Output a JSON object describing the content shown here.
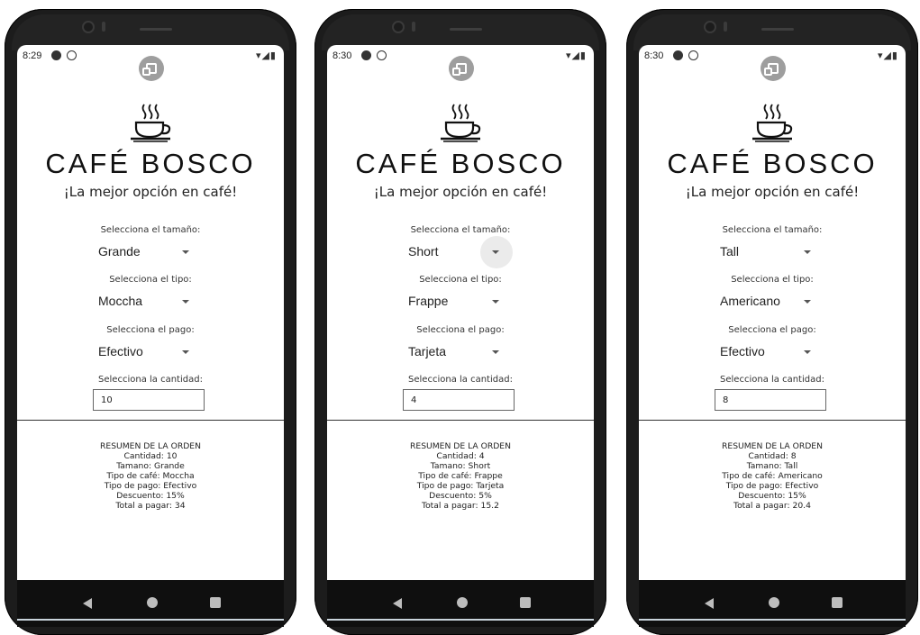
{
  "phones": [
    {
      "time": "8:29",
      "brand": "CAFÉ BOSCO",
      "tagline": "¡La mejor opción en café!",
      "size_label": "Selecciona el tamaño:",
      "size_value": "Grande",
      "type_label": "Selecciona el tipo:",
      "type_value": "Moccha",
      "payment_label": "Selecciona el pago:",
      "payment_value": "Efectivo",
      "quantity_label": "Selecciona la cantidad:",
      "quantity_value": "10",
      "summary": {
        "title": "RESUMEN DE LA ORDEN",
        "quantity": "Cantidad:   10",
        "size": "Tamano:   Grande",
        "coffee_type": "Tipo de café:    Moccha",
        "payment_type": "Tipo de pago:   Efectivo",
        "discount": "Descuento:   15%",
        "total": "Total a pagar:   34"
      }
    },
    {
      "time": "8:30",
      "brand": "CAFÉ BOSCO",
      "tagline": "¡La mejor opción en café!",
      "size_label": "Selecciona el tamaño:",
      "size_value": "Short",
      "type_label": "Selecciona el tipo:",
      "type_value": "Frappe",
      "payment_label": "Selecciona el pago:",
      "payment_value": "Tarjeta",
      "quantity_label": "Selecciona la cantidad:",
      "quantity_value": "4",
      "summary": {
        "title": "RESUMEN DE LA ORDEN",
        "quantity": "Cantidad:   4",
        "size": "Tamano:   Short",
        "coffee_type": "Tipo de café:    Frappe",
        "payment_type": "Tipo de pago:   Tarjeta",
        "discount": "Descuento:   5%",
        "total": "Total a pagar:   15.2"
      }
    },
    {
      "time": "8:30",
      "brand": "CAFÉ BOSCO",
      "tagline": "¡La mejor opción en café!",
      "size_label": "Selecciona el tamaño:",
      "size_value": "Tall",
      "type_label": "Selecciona el tipo:",
      "type_value": "Americano",
      "payment_label": "Selecciona el pago:",
      "payment_value": "Efectivo",
      "quantity_label": "Selecciona la cantidad:",
      "quantity_value": "8",
      "summary": {
        "title": "RESUMEN DE LA ORDEN",
        "quantity": "Cantidad:   8",
        "size": "Tamano:   Tall",
        "coffee_type": "Tipo de café:   Americano",
        "payment_type": "Tipo de pago:   Efectivo",
        "discount": "Descuento:   15%",
        "total": "Total a pagar:   20.4"
      }
    }
  ],
  "icons": {
    "status_left_1": "android-notification-icon",
    "status_left_2": "at-sign-icon",
    "status_right": "wifi-signal-battery-icons",
    "fab": "rotate-screen-icon",
    "logo": "coffee-cup-icon",
    "spinner_arrow": "dropdown-arrow-icon",
    "nav_back": "back-triangle-icon",
    "nav_home": "home-circle-icon",
    "nav_recent": "recent-apps-square-icon"
  },
  "colors": {
    "device": "#1c1c1c",
    "nav_bar": "#0f0f0f",
    "fab": "#9e9e9e"
  }
}
